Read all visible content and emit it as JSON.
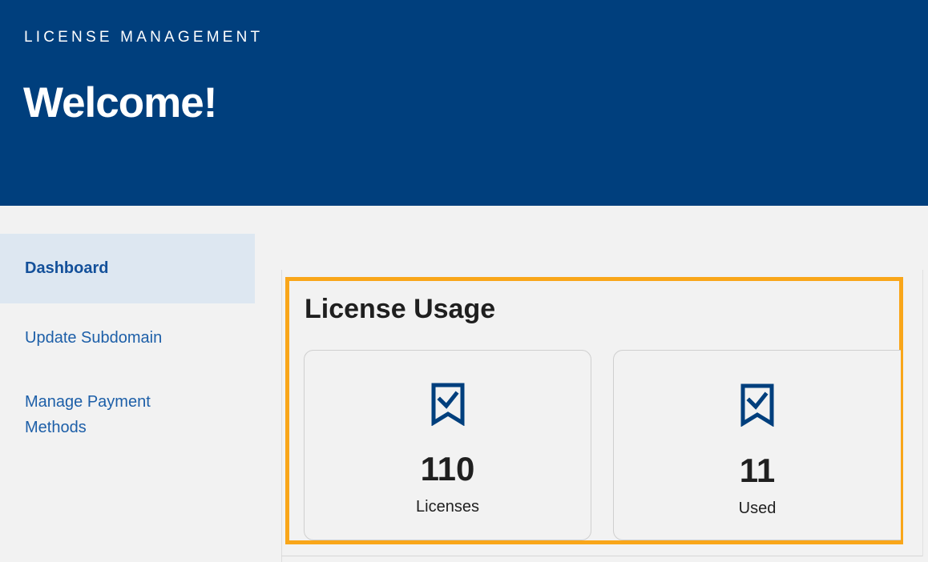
{
  "header": {
    "eyebrow": "LICENSE MANAGEMENT",
    "welcome": "Welcome!"
  },
  "sidebar": {
    "items": [
      {
        "label": "Dashboard",
        "active": true
      },
      {
        "label": "Update Subdomain",
        "active": false
      },
      {
        "label": "Manage Payment Methods",
        "active": false
      }
    ]
  },
  "usage": {
    "title": "License Usage",
    "highlight_color": "#f9a61a",
    "cards": [
      {
        "value": "110",
        "label": "Licenses",
        "icon": "bookmark-check-icon"
      },
      {
        "value": "11",
        "label": "Used",
        "icon": "bookmark-check-icon"
      }
    ]
  },
  "colors": {
    "brand": "#003f7d",
    "link": "#1d5fa8",
    "active_bg": "#dde7f1"
  }
}
